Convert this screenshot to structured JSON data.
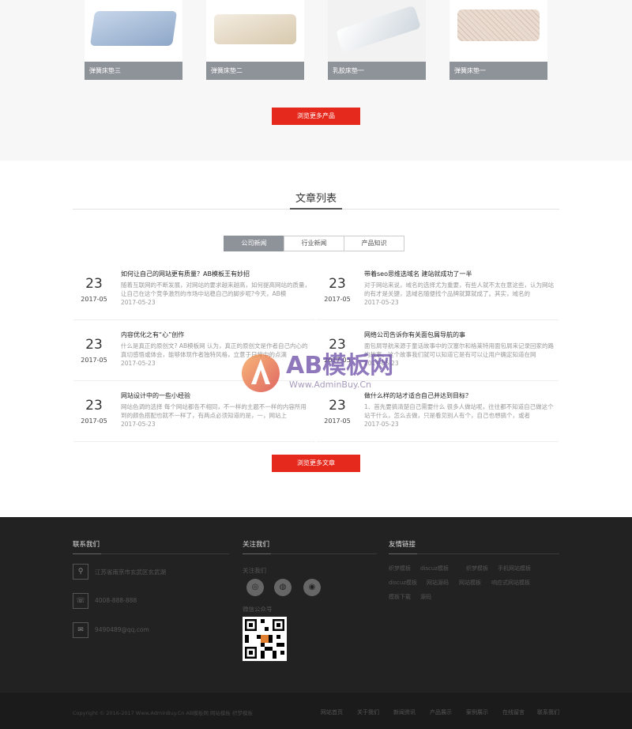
{
  "products": {
    "items": [
      {
        "caption": "弹簧床垫三",
        "color": "#9fb6d4"
      },
      {
        "caption": "弹簧床垫二",
        "color": "#e8dcc6"
      },
      {
        "caption": "乳胶床垫一",
        "color": "#e6eaef"
      },
      {
        "caption": "弹簧床垫一",
        "color": "#e3d5c9"
      }
    ],
    "more_label": "浏览更多产品"
  },
  "articles": {
    "title": "文章列表",
    "tabs": [
      "公司新闻",
      "行业新闻",
      "产品知识"
    ],
    "items": [
      {
        "day": "23",
        "ym": "2017-05",
        "title": "如何让自己的网站更有质量？AB模板王有妙招",
        "desc": "随着互联网的不断发展，对网站的要求越来越高，如何提高网站的质量，让自己在这个竞争激烈的市场中站稳自己的脚步呢?今天，AB模",
        "date": "2017-05-23"
      },
      {
        "day": "23",
        "ym": "2017-05",
        "title": "带着seo思维选域名 建站就成功了一半",
        "desc": "对于网站来说，域名的选择尤为重要，有些人就不太在意这些，认为网站的有才是关键，选域名随便找个品牌就算就成了。其实，域名的",
        "date": "2017-05-23"
      },
      {
        "day": "23",
        "ym": "2017-05",
        "title": "内容优化之有“心”创作",
        "desc": "什么是真正的原创文? AB模板网 认为，真正的原创文是作者自己内心的真切感悟或体会，能够体现作者独特风格，立意于日常中的点滴",
        "date": "2017-05-23"
      },
      {
        "day": "23",
        "ym": "2017-05",
        "title": "网络公司告诉你有关面包屑导航的事",
        "desc": "面包屑导航来源于童话故事中的汉塞尔和格莱特用面包屑来记录回家的路的故事。这个故事我们就可以知道它是有可以让用户确定知道在网",
        "date": "2017-05-23"
      },
      {
        "day": "23",
        "ym": "2017-05",
        "title": "网站设计中的一些小经验",
        "desc": "网站色调的选择 每个网站都各不相同，不一样的主题不一样的内容所用到的颜色搭配也就不一样了，有两点必须知道的是，一，网站上",
        "date": "2017-05-23"
      },
      {
        "day": "23",
        "ym": "2017-05",
        "title": "做什么样的站才适合自己并达到目标？",
        "desc": "1、首先要搞清楚自己需要什么 很多人做站呢，往往都不知道自己做这个站干什么，怎么去做，只是看见别人有个，自己也想搞个，或者",
        "date": "2017-05-23"
      }
    ],
    "more_label": "浏览更多文章"
  },
  "watermark": {
    "brand": "AB模板网",
    "url": "Www.AdminBuy.Cn"
  },
  "footer": {
    "contact": {
      "title": "联系我们",
      "address": "江苏省南京市玄武区玄武湖",
      "phone": "4008-888-888",
      "email": "9490489@qq.com"
    },
    "follow": {
      "title": "关注我们",
      "share_label": "关注我们",
      "wechat_label": "微信公众号"
    },
    "links": {
      "title": "友情链接",
      "items": [
        "织梦模板",
        "discuz模板",
        "织梦模板",
        "手机网站模板",
        "discuz模板",
        "网站源码",
        "网站模板",
        "响应式网站模板",
        "模板下载",
        "源码"
      ]
    },
    "copyright": "Copyright © 2016-2017 Www.AdminBuy.Cn AB模板网 网站模板 织梦模板",
    "bottom_nav": [
      "网站首页",
      "关于我们",
      "新闻资讯",
      "产品展示",
      "案例展示",
      "在线留言",
      "联系我们"
    ]
  }
}
